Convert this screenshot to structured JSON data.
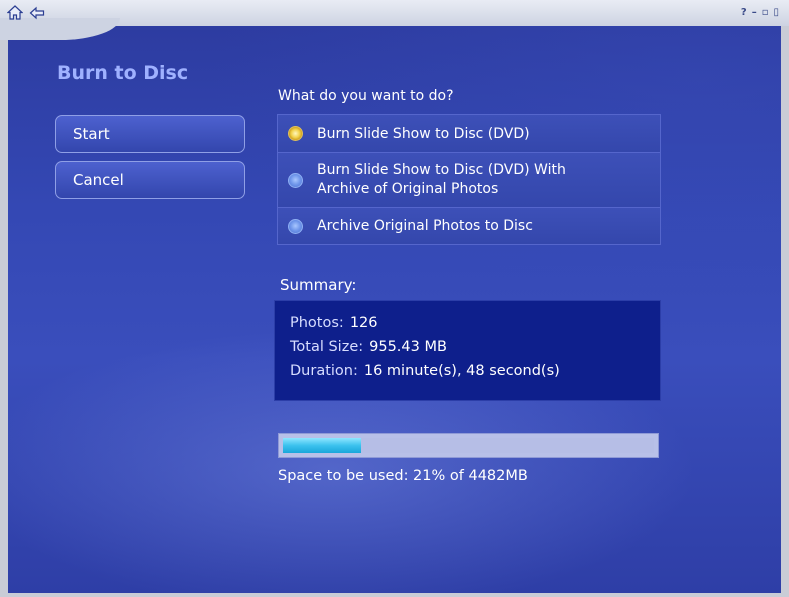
{
  "window": {
    "help_glyph": "?",
    "minimize_glyph": "–",
    "restore_glyph": "▫",
    "close_glyph": "▯"
  },
  "heading": "Burn to Disc",
  "buttons": {
    "start": "Start",
    "cancel": "Cancel"
  },
  "prompt": "What do you want to do?",
  "options": [
    {
      "label": "Burn Slide Show to Disc (DVD)",
      "selected": true
    },
    {
      "label_line1": "Burn Slide Show to Disc (DVD) With",
      "label_line2": "Archive of Original Photos",
      "selected": false
    },
    {
      "label": "Archive Original Photos to Disc",
      "selected": false
    }
  ],
  "summary": {
    "title": "Summary:",
    "photos_label": "Photos:",
    "photos_value": "126",
    "size_label": "Total Size:",
    "size_value": "955.43 MB",
    "duration_label": "Duration:",
    "duration_value": "16 minute(s), 48 second(s)"
  },
  "space": {
    "percent_used": 21,
    "text": "Space to be used: 21% of 4482MB"
  },
  "colors": {
    "background": "#3448b4",
    "heading": "#9fb1ff",
    "summary_box": "#0e1f8c",
    "progress_fill": "#3cc2ee",
    "radio_selected": "#f2d24a",
    "radio_unselected": "#6f96ea"
  }
}
